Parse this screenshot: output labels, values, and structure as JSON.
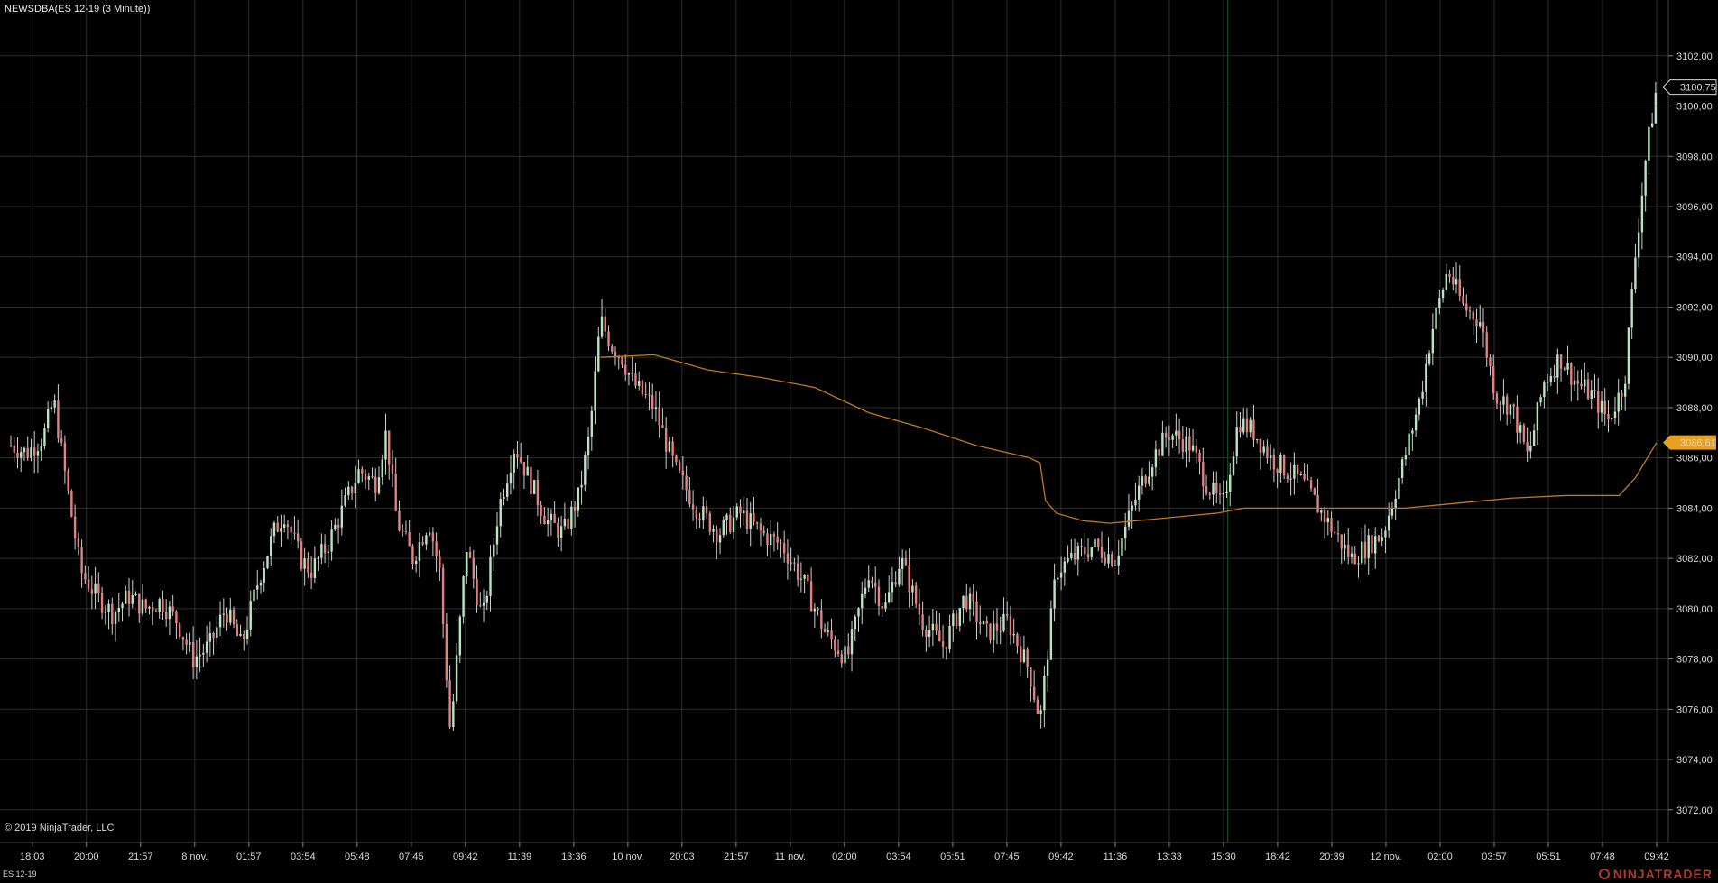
{
  "window": {
    "title": "NEWSDBA(ES 12-19 (3 Minute))",
    "copyright": "© 2019 NinjaTrader, LLC",
    "instrument": "ES 12-19",
    "brand": "NINJATRADER"
  },
  "colors": {
    "background": "#000000",
    "grid": "#2e2e2e",
    "candle_up": "#b9e4c2",
    "candle_down": "#e58080",
    "vwap_line": "#c07a18",
    "last_price_marker": "#000000",
    "vwap_marker": "#e8a020",
    "session_divider": "#1e5a2a"
  },
  "chart_data": {
    "type": "candlestick",
    "title": "NEWSDBA(ES 12-19 (3 Minute))",
    "x_tick_labels": [
      "18:03",
      "20:00",
      "21:57",
      "8 nov.",
      "01:57",
      "03:54",
      "05:48",
      "07:45",
      "09:42",
      "11:39",
      "13:36",
      "10 nov.",
      "20:03",
      "21:57",
      "11 nov.",
      "02:00",
      "03:54",
      "05:51",
      "07:45",
      "09:42",
      "11:36",
      "13:33",
      "15:30",
      "18:42",
      "20:39",
      "12 nov.",
      "02:00",
      "03:57",
      "05:51",
      "07:48",
      "09:42"
    ],
    "y_tick_labels": [
      "3102,00",
      "3100,00",
      "3098,00",
      "3096,00",
      "3094,00",
      "3092,00",
      "3090,00",
      "3088,00",
      "3086,00",
      "3084,00",
      "3082,00",
      "3080,00",
      "3078,00",
      "3076,00",
      "3074,00",
      "3072,00"
    ],
    "y_ticks": [
      3102,
      3100,
      3098,
      3096,
      3094,
      3092,
      3090,
      3088,
      3086,
      3084,
      3082,
      3080,
      3078,
      3076,
      3074,
      3072
    ],
    "ylim": [
      3070.7,
      3103.5
    ],
    "xlim": [
      0,
      30.7
    ],
    "session_divider_x": 22.7,
    "close_series": [
      [
        0,
        3086.5
      ],
      [
        0.3,
        3086.2
      ],
      [
        0.6,
        3086.8
      ],
      [
        0.8,
        3088.3
      ],
      [
        1.0,
        3085.5
      ],
      [
        1.3,
        3081.5
      ],
      [
        1.6,
        3080.5
      ],
      [
        1.9,
        3079.8
      ],
      [
        2.2,
        3080.5
      ],
      [
        2.5,
        3080.0
      ],
      [
        2.8,
        3080.3
      ],
      [
        3.1,
        3079.5
      ],
      [
        3.4,
        3078.0
      ],
      [
        3.7,
        3078.5
      ],
      [
        4.0,
        3080.0
      ],
      [
        4.3,
        3078.5
      ],
      [
        4.6,
        3081.0
      ],
      [
        4.9,
        3083.0
      ],
      [
        5.1,
        3083.8
      ],
      [
        5.4,
        3082.0
      ],
      [
        5.6,
        3081.5
      ],
      [
        5.9,
        3082.5
      ],
      [
        6.2,
        3084.0
      ],
      [
        6.5,
        3085.5
      ],
      [
        6.8,
        3085.0
      ],
      [
        7.0,
        3087.0
      ],
      [
        7.2,
        3083.5
      ],
      [
        7.5,
        3082.0
      ],
      [
        7.8,
        3083.5
      ],
      [
        8.0,
        3081.5
      ],
      [
        8.2,
        3075.0
      ],
      [
        8.5,
        3082.5
      ],
      [
        8.8,
        3079.5
      ],
      [
        9.1,
        3084.0
      ],
      [
        9.4,
        3086.5
      ],
      [
        9.7,
        3085.0
      ],
      [
        10.0,
        3083.5
      ],
      [
        10.3,
        3083.0
      ],
      [
        10.6,
        3084.5
      ],
      [
        10.8,
        3087.0
      ],
      [
        11.0,
        3091.5
      ],
      [
        11.2,
        3090.5
      ],
      [
        11.4,
        3090.0
      ],
      [
        11.6,
        3089.0
      ],
      [
        12.0,
        3088.0
      ],
      [
        12.4,
        3085.5
      ],
      [
        12.8,
        3084.0
      ],
      [
        13.2,
        3083.0
      ],
      [
        13.6,
        3083.8
      ],
      [
        14.0,
        3083.0
      ],
      [
        14.4,
        3082.5
      ],
      [
        14.8,
        3081.0
      ],
      [
        15.2,
        3079.0
      ],
      [
        15.6,
        3078.0
      ],
      [
        16.0,
        3081.5
      ],
      [
        16.3,
        3080.0
      ],
      [
        16.6,
        3082.0
      ],
      [
        17.0,
        3079.5
      ],
      [
        17.4,
        3078.5
      ],
      [
        17.8,
        3080.5
      ],
      [
        18.2,
        3079.0
      ],
      [
        18.6,
        3079.5
      ],
      [
        19.0,
        3077.5
      ],
      [
        19.2,
        3075.5
      ],
      [
        19.5,
        3081.5
      ],
      [
        19.8,
        3082.0
      ],
      [
        20.2,
        3082.5
      ],
      [
        20.6,
        3082.0
      ],
      [
        21.0,
        3084.5
      ],
      [
        21.3,
        3086.0
      ],
      [
        21.6,
        3087.0
      ],
      [
        22.0,
        3086.5
      ],
      [
        22.3,
        3085.0
      ],
      [
        22.6,
        3084.0
      ],
      [
        22.9,
        3087.5
      ],
      [
        23.2,
        3087.0
      ],
      [
        23.5,
        3086.0
      ],
      [
        23.8,
        3085.5
      ],
      [
        24.1,
        3085.0
      ],
      [
        24.4,
        3084.0
      ],
      [
        24.7,
        3083.0
      ],
      [
        25.0,
        3082.0
      ],
      [
        25.3,
        3082.5
      ],
      [
        25.6,
        3083.0
      ],
      [
        25.8,
        3084.5
      ],
      [
        26.0,
        3086.0
      ],
      [
        26.3,
        3088.5
      ],
      [
        26.5,
        3091.0
      ],
      [
        26.8,
        3093.5
      ],
      [
        27.1,
        3092.0
      ],
      [
        27.4,
        3091.5
      ],
      [
        27.7,
        3088.5
      ],
      [
        28.0,
        3088.0
      ],
      [
        28.3,
        3086.0
      ],
      [
        28.6,
        3089.0
      ],
      [
        28.9,
        3090.0
      ],
      [
        29.2,
        3089.0
      ],
      [
        29.5,
        3088.5
      ],
      [
        29.8,
        3087.5
      ],
      [
        30.1,
        3089.0
      ],
      [
        30.3,
        3094.0
      ],
      [
        30.5,
        3098.0
      ],
      [
        30.7,
        3100.75
      ]
    ],
    "vwap_series": [
      [
        11.0,
        3090.0
      ],
      [
        12.0,
        3090.1
      ],
      [
        13.0,
        3089.5
      ],
      [
        14.0,
        3089.2
      ],
      [
        15.0,
        3088.8
      ],
      [
        16.0,
        3087.8
      ],
      [
        17.0,
        3087.2
      ],
      [
        18.0,
        3086.5
      ],
      [
        19.0,
        3086.0
      ],
      [
        19.2,
        3085.8
      ],
      [
        19.3,
        3084.3
      ],
      [
        19.5,
        3083.8
      ],
      [
        20.0,
        3083.5
      ],
      [
        20.5,
        3083.4
      ],
      [
        21.0,
        3083.5
      ],
      [
        22.0,
        3083.7
      ],
      [
        22.5,
        3083.8
      ],
      [
        23.0,
        3084.0
      ],
      [
        24.0,
        3084.0
      ],
      [
        25.0,
        3084.0
      ],
      [
        26.0,
        3084.0
      ],
      [
        27.0,
        3084.2
      ],
      [
        28.0,
        3084.4
      ],
      [
        29.0,
        3084.5
      ],
      [
        30.0,
        3084.5
      ],
      [
        30.3,
        3085.2
      ],
      [
        30.7,
        3086.61
      ]
    ],
    "last_price_label": "3100,75",
    "last_price": 3100.75,
    "vwap_label": "3086,61",
    "vwap_value": 3086.61
  }
}
